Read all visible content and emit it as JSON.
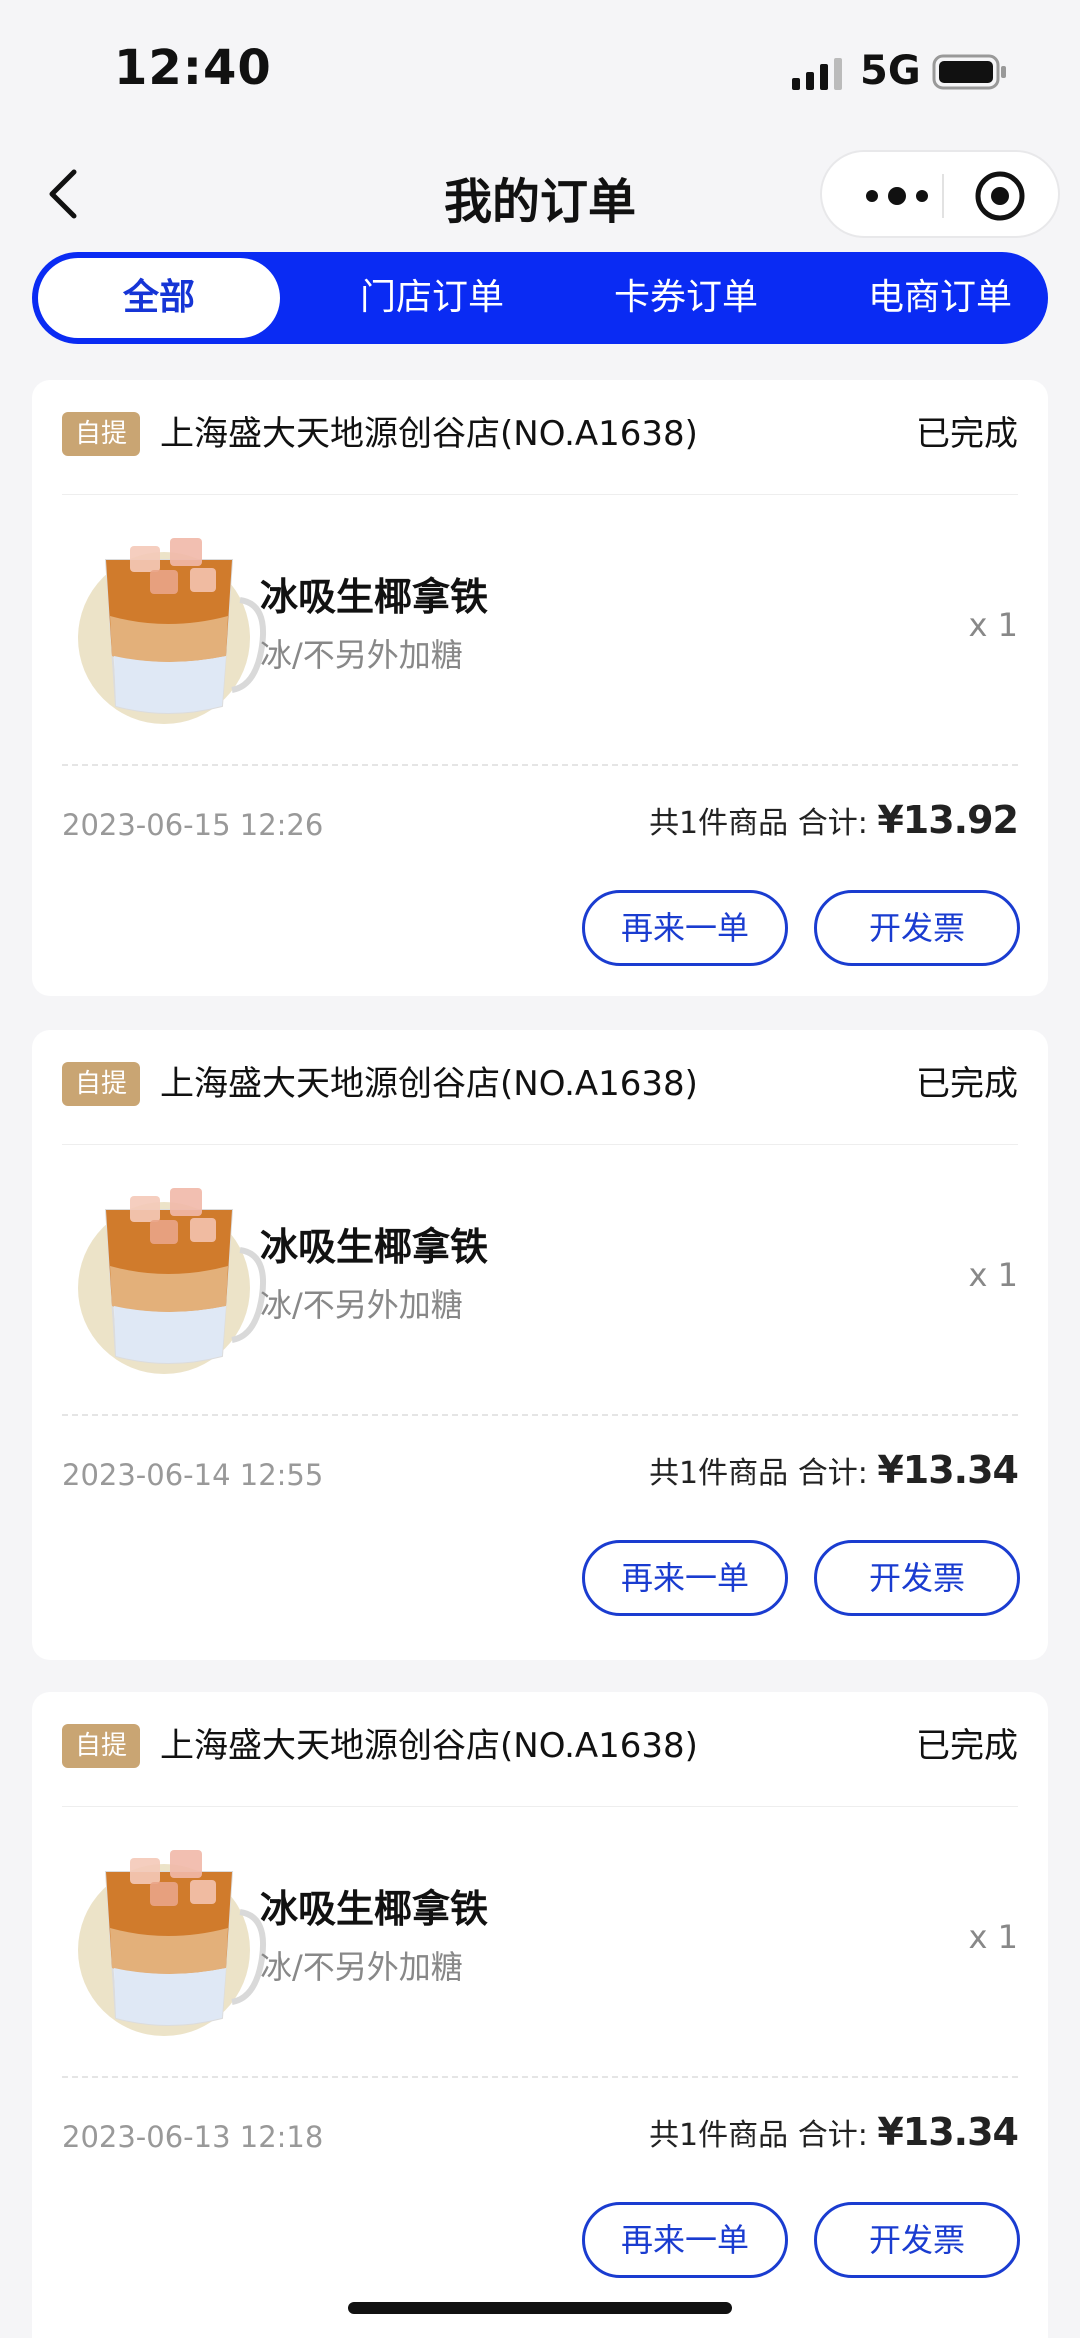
{
  "status_bar": {
    "time": "12:40",
    "network": "5G"
  },
  "nav": {
    "title": "我的订单"
  },
  "tabs": [
    {
      "label": "全部",
      "active": true
    },
    {
      "label": "门店订单",
      "active": false
    },
    {
      "label": "卡券订单",
      "active": false
    },
    {
      "label": "电商订单",
      "active": false
    }
  ],
  "orders": [
    {
      "badge": "自提",
      "store": "上海盛大天地源创谷店(NO.A1638)",
      "status": "已完成",
      "product_name": "冰吸生椰拿铁",
      "product_spec": "冰/不另外加糖",
      "quantity": "x 1",
      "date": "2023-06-15 12:26",
      "item_count": "共1件商品",
      "total_label": "合计:",
      "total": "¥13.92",
      "reorder_label": "再来一单",
      "invoice_label": "开发票"
    },
    {
      "badge": "自提",
      "store": "上海盛大天地源创谷店(NO.A1638)",
      "status": "已完成",
      "product_name": "冰吸生椰拿铁",
      "product_spec": "冰/不另外加糖",
      "quantity": "x 1",
      "date": "2023-06-14 12:55",
      "item_count": "共1件商品",
      "total_label": "合计:",
      "total": "¥13.34",
      "reorder_label": "再来一单",
      "invoice_label": "开发票"
    },
    {
      "badge": "自提",
      "store": "上海盛大天地源创谷店(NO.A1638)",
      "status": "已完成",
      "product_name": "冰吸生椰拿铁",
      "product_spec": "冰/不另外加糖",
      "quantity": "x 1",
      "date": "2023-06-13 12:18",
      "item_count": "共1件商品",
      "total_label": "合计:",
      "total": "¥13.34",
      "reorder_label": "再来一单",
      "invoice_label": "开发票"
    }
  ],
  "colors": {
    "accent": "#0a2bf3",
    "badge": "#c9a573",
    "button": "#1a3cd0"
  },
  "icons": [
    "signal-icon",
    "battery-icon",
    "back-icon",
    "more-icon",
    "target-icon",
    "latte-cup-icon"
  ]
}
